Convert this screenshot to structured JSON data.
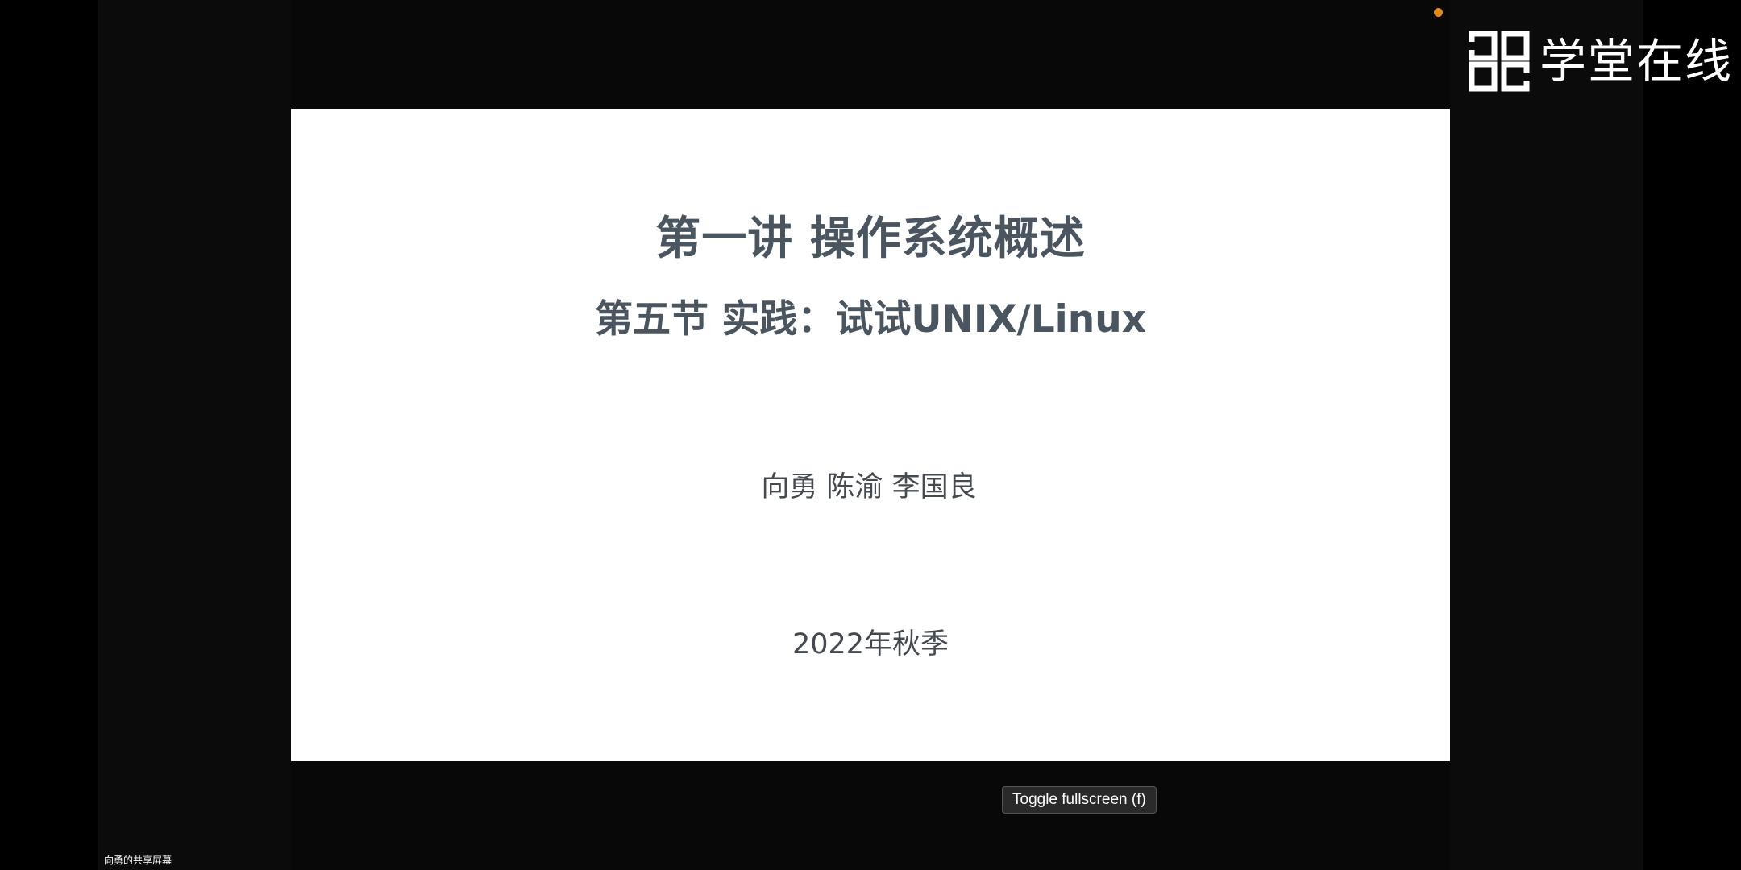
{
  "slide": {
    "title": "第一讲 操作系统概述",
    "subtitle": "第五节 实践：试试UNIX/Linux",
    "authors": "向勇 陈渝 李国良",
    "date": "2022年秋季"
  },
  "watermark": {
    "text": "学堂在线",
    "icon": "xuetangx-logo-icon"
  },
  "controls": {
    "fullscreen_tooltip": "Toggle fullscreen (f)"
  },
  "participant": {
    "label": "向勇的共享屏幕"
  },
  "colors": {
    "slide_background": "#ffffff",
    "slide_text": "#4a5560",
    "recording_indicator": "#e08a1c",
    "background": "#000000"
  }
}
